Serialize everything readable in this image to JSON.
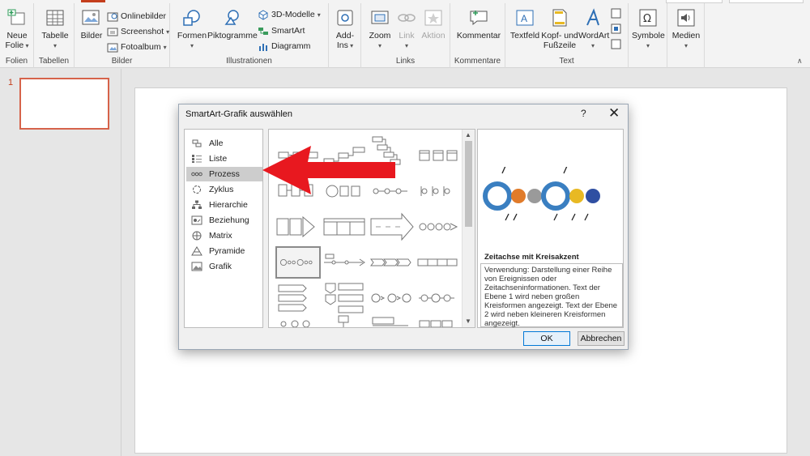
{
  "ribbon": {
    "groups": {
      "folien": "Folien",
      "tabellen": "Tabellen",
      "bilder": "Bilder",
      "illustrationen": "Illustrationen",
      "links": "Links",
      "kommentare": "Kommentare",
      "text": "Text"
    },
    "buttons": {
      "neue_folie": "Neue Folie",
      "tabelle": "Tabelle",
      "bilder": "Bilder",
      "onlinebilder": "Onlinebilder",
      "screenshot": "Screenshot",
      "fotoalbum": "Fotoalbum",
      "formen": "Formen",
      "piktogramme": "Piktogramme",
      "modelle_3d": "3D-Modelle",
      "smartart": "SmartArt",
      "diagramm": "Diagramm",
      "addins": "Add-Ins",
      "zoom": "Zoom",
      "link": "Link",
      "aktion": "Aktion",
      "kommentar": "Kommentar",
      "textfeld": "Textfeld",
      "kopf_fusszeile": "Kopf- und Fußzeile",
      "wordart": "WordArt",
      "symbole": "Symbole",
      "medien": "Medien"
    }
  },
  "slide_pane": {
    "slide_number": "1"
  },
  "dialog": {
    "title": "SmartArt-Grafik auswählen",
    "help": "?",
    "close": "✕",
    "categories": [
      {
        "label": "Alle",
        "icon": "all-icon",
        "selected": false
      },
      {
        "label": "Liste",
        "icon": "list-icon",
        "selected": false
      },
      {
        "label": "Prozess",
        "icon": "process-icon",
        "selected": true
      },
      {
        "label": "Zyklus",
        "icon": "cycle-icon",
        "selected": false
      },
      {
        "label": "Hierarchie",
        "icon": "hierarchy-icon",
        "selected": false
      },
      {
        "label": "Beziehung",
        "icon": "relationship-icon",
        "selected": false
      },
      {
        "label": "Matrix",
        "icon": "matrix-icon",
        "selected": false
      },
      {
        "label": "Pyramide",
        "icon": "pyramid-icon",
        "selected": false
      },
      {
        "label": "Grafik",
        "icon": "picture-icon",
        "selected": false
      }
    ],
    "preview": {
      "title": "Zeitachse mit Kreisakzent",
      "description": "Verwendung: Darstellung einer Reihe von Ereignissen oder Zeitachseninformationen. Text der Ebene 1 wird neben großen Kreisformen angezeigt. Text der Ebene 2 wird neben kleineren Kreisformen angezeigt."
    },
    "ok_label": "OK",
    "cancel_label": "Abbrechen"
  },
  "colors": {
    "accent": "#c43e1c",
    "arrow": "#e8181f",
    "preview_blue": "#3a7fc1",
    "preview_orange": "#e07b2a",
    "preview_gray": "#9a9a9a",
    "preview_gold": "#e8b923",
    "preview_navy": "#2f4fa2"
  }
}
